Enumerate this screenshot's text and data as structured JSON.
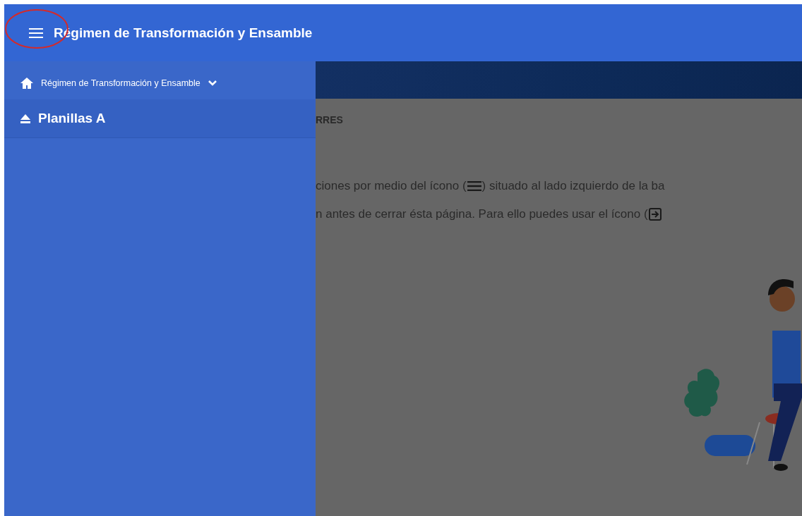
{
  "app_bar": {
    "title": "Régimen de Transformación y Ensamble"
  },
  "drawer": {
    "items": [
      {
        "kind": "home",
        "label": "Régimen de Transformación y Ensamble",
        "selected": false
      },
      {
        "kind": "eject",
        "label": "Planillas A",
        "selected": true
      }
    ]
  },
  "content": {
    "heading": "RRES",
    "lines": [
      {
        "before": "ciones por medio del ícono (",
        "kind": "menu",
        "after": ") situado al lado izquierdo de la ba"
      },
      {
        "before": "n antes de cerrar ésta página. Para ello puedes usar el ícono (",
        "kind": "exit"
      }
    ]
  }
}
